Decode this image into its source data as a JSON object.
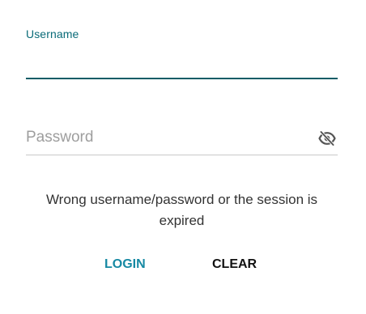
{
  "form": {
    "username": {
      "label": "Username",
      "value": "",
      "accent_color": "#0a6b78"
    },
    "password": {
      "placeholder": "Password",
      "value": "",
      "visibility_icon": "eye-off-icon"
    },
    "error_message": "Wrong username/password or the session is expired",
    "buttons": {
      "login_label": "LOGIN",
      "login_color": "#1689a3",
      "clear_label": "CLEAR",
      "clear_color": "#111111"
    }
  }
}
